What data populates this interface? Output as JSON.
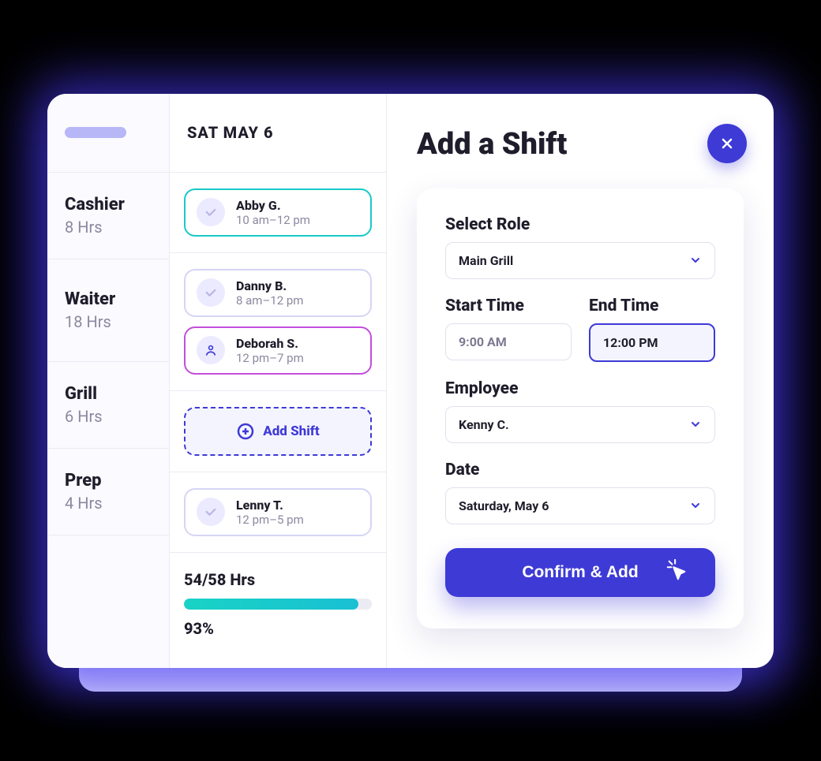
{
  "header": {
    "day_label": "SAT MAY 6"
  },
  "roles": [
    {
      "name": "Cashier",
      "hours": "8 Hrs"
    },
    {
      "name": "Waiter",
      "hours": "18 Hrs"
    },
    {
      "name": "Grill",
      "hours": "6 Hrs"
    },
    {
      "name": "Prep",
      "hours": "4 Hrs"
    }
  ],
  "shifts": {
    "cashier": [
      {
        "name": "Abby G.",
        "time": "10 am–12 pm",
        "icon": "check",
        "style": "teal"
      }
    ],
    "waiter": [
      {
        "name": "Danny B.",
        "time": "8 am–12 pm",
        "icon": "check",
        "style": "lav"
      },
      {
        "name": "Deborah S.",
        "time": "12 pm–7 pm",
        "icon": "person",
        "style": "mag"
      }
    ],
    "grill_add_label": "Add Shift",
    "prep": [
      {
        "name": "Lenny T.",
        "time": "12 pm–5 pm",
        "icon": "check",
        "style": "lav"
      }
    ]
  },
  "summary": {
    "ratio": "54/58 Hrs",
    "percent": "93%",
    "percent_num": 93
  },
  "panel": {
    "title": "Add a Shift",
    "role_label": "Select Role",
    "role_value": "Main Grill",
    "start_label": "Start Time",
    "start_value": "9:00 AM",
    "end_label": "End Time",
    "end_value": "12:00 PM",
    "employee_label": "Employee",
    "employee_value": "Kenny C.",
    "date_label": "Date",
    "date_value": "Saturday, May 6",
    "confirm_label": "Confirm & Add"
  }
}
